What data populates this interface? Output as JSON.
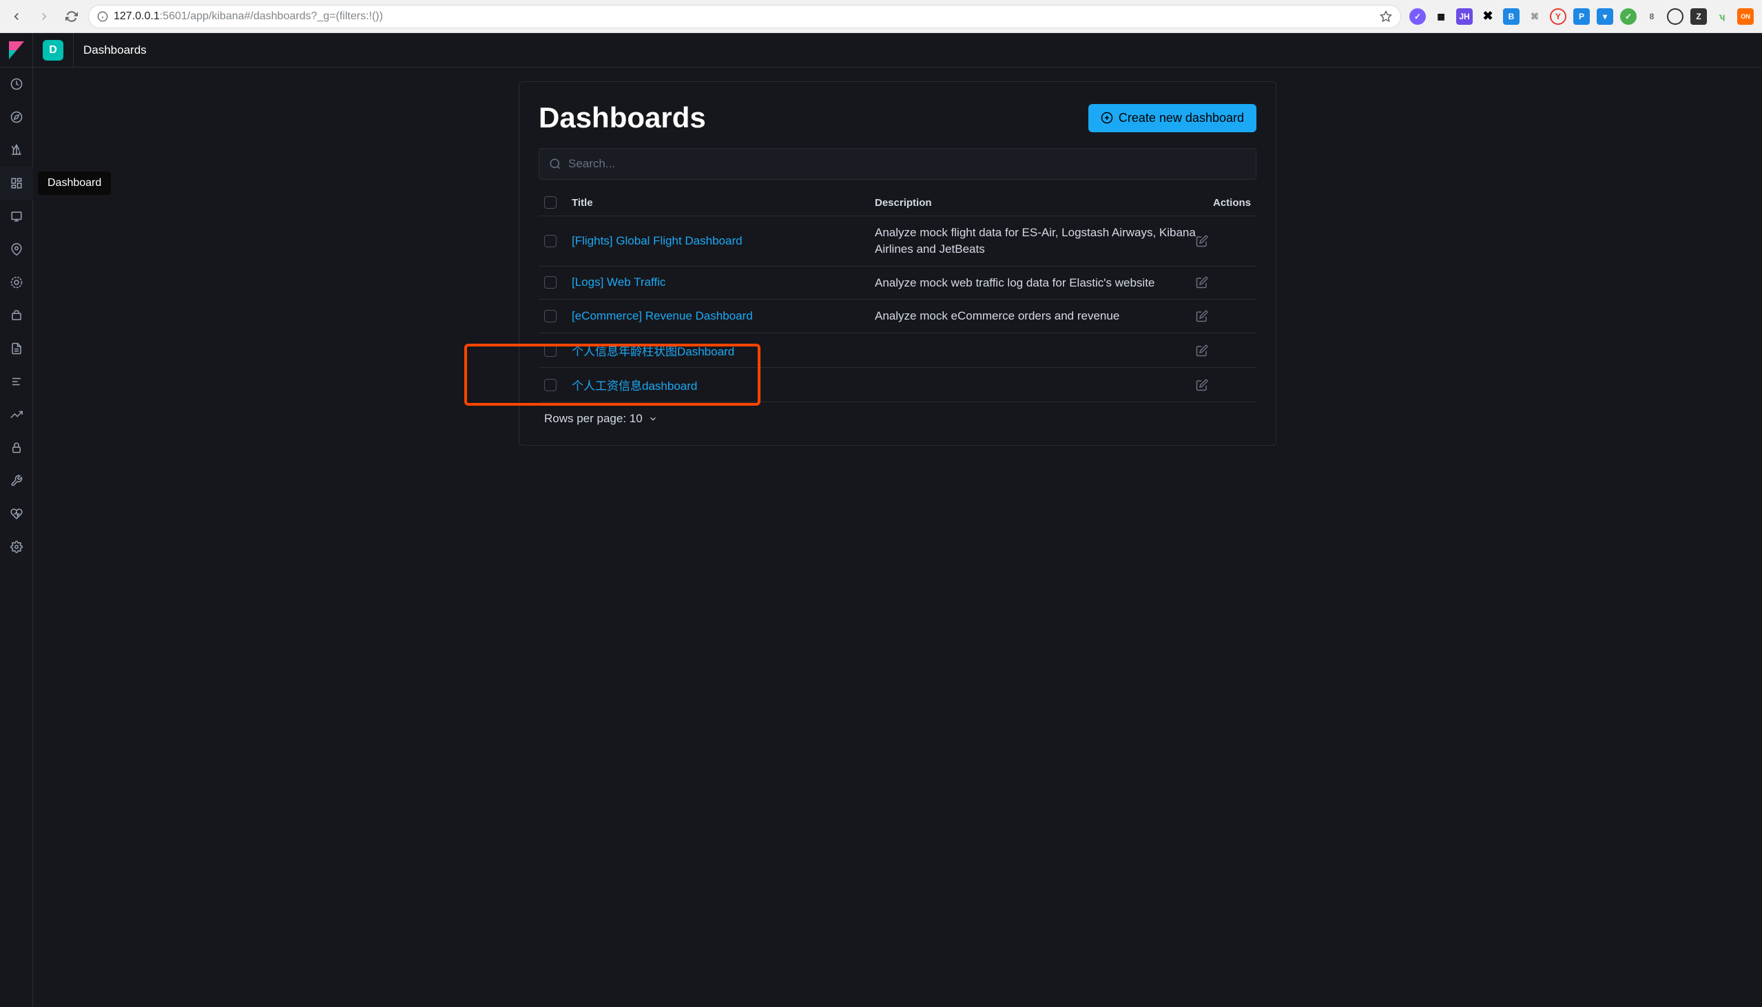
{
  "browser": {
    "url_host": "127.0.0.1",
    "url_port": ":5601",
    "url_path": "/app/kibana#/dashboards?_g=(filters:!())"
  },
  "space_badge": "D",
  "breadcrumb": "Dashboards",
  "tooltip": "Dashboard",
  "page": {
    "title": "Dashboards",
    "create_button": "Create new dashboard",
    "search_placeholder": "Search...",
    "rows_per_page_label": "Rows per page: 10"
  },
  "table": {
    "headers": {
      "title": "Title",
      "description": "Description",
      "actions": "Actions"
    },
    "rows": [
      {
        "title": "[Flights] Global Flight Dashboard",
        "description": "Analyze mock flight data for ES-Air, Logstash Airways, Kibana Airlines and JetBeats"
      },
      {
        "title": "[Logs] Web Traffic",
        "description": "Analyze mock web traffic log data for Elastic's website"
      },
      {
        "title": "[eCommerce] Revenue Dashboard",
        "description": "Analyze mock eCommerce orders and revenue"
      },
      {
        "title": "个人信息年龄柱状图Dashboard",
        "description": ""
      },
      {
        "title": "个人工资信息dashboard",
        "description": ""
      }
    ]
  },
  "sidebar_items": [
    {
      "name": "recent",
      "icon": "clock"
    },
    {
      "name": "discover",
      "icon": "compass"
    },
    {
      "name": "visualize",
      "icon": "barchart"
    },
    {
      "name": "dashboard",
      "icon": "dashboard",
      "active": true,
      "tooltip": true
    },
    {
      "name": "canvas",
      "icon": "canvas"
    },
    {
      "name": "maps",
      "icon": "maps"
    },
    {
      "name": "ml",
      "icon": "ml"
    },
    {
      "name": "infrastructure",
      "icon": "infra"
    },
    {
      "name": "logs",
      "icon": "logs"
    },
    {
      "name": "apm",
      "icon": "apm"
    },
    {
      "name": "uptime",
      "icon": "uptime"
    },
    {
      "name": "security",
      "icon": "lock"
    },
    {
      "name": "devtools",
      "icon": "wrench"
    },
    {
      "name": "monitoring",
      "icon": "heartbeat"
    },
    {
      "name": "management",
      "icon": "gear"
    }
  ]
}
